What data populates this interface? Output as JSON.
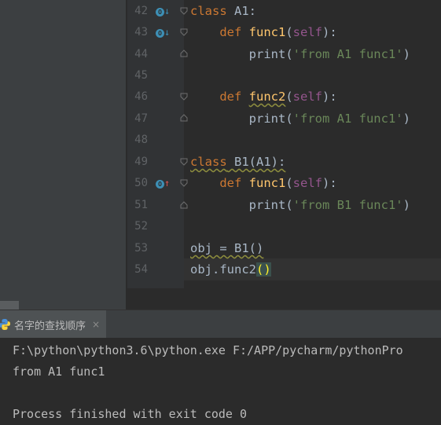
{
  "editor": {
    "line_numbers": [
      "42",
      "43",
      "44",
      "45",
      "46",
      "47",
      "48",
      "49",
      "50",
      "51",
      "52",
      "53",
      "54"
    ],
    "lines": {
      "l42": {
        "kw": "class",
        "name": " A1:"
      },
      "l43": {
        "indent": "    ",
        "kw": "def ",
        "fn": "func1",
        "open": "(",
        "self": "self",
        "close": "):"
      },
      "l44": {
        "indent": "        ",
        "print": "print(",
        "str": "'from A1 func1'",
        "end": ")"
      },
      "l46": {
        "indent": "    ",
        "kw": "def ",
        "fn": "func2",
        "open": "(",
        "self": "self",
        "close": "):"
      },
      "l47": {
        "indent": "        ",
        "print": "print(",
        "str": "'from A1 func1'",
        "end": ")"
      },
      "l49": {
        "kw": "class",
        "name": " B1(A1):"
      },
      "l50": {
        "indent": "    ",
        "kw": "def ",
        "fn": "func1",
        "open": "(",
        "self": "self",
        "close": "):"
      },
      "l51": {
        "indent": "        ",
        "print": "print(",
        "str": "'from B1 func1'",
        "end": ")"
      },
      "l53": {
        "text": "obj = B1()"
      },
      "l54": {
        "text": "obj.func2",
        "paren": "()"
      }
    }
  },
  "run_panel": {
    "tab_label": "名字的查找顺序",
    "close_symbol": "×",
    "output": [
      "F:\\python\\python3.6\\python.exe F:/APP/pycharm/pythonPro",
      "from A1 func1",
      "",
      "Process finished with exit code 0"
    ]
  },
  "colors": {
    "keyword": "#cc7832",
    "function": "#ffc66d",
    "self": "#94558d",
    "string": "#6a8759",
    "text": "#a9b7c6",
    "gutter_icon": "#3d8fb5",
    "override_arrow": "#d9534f"
  }
}
